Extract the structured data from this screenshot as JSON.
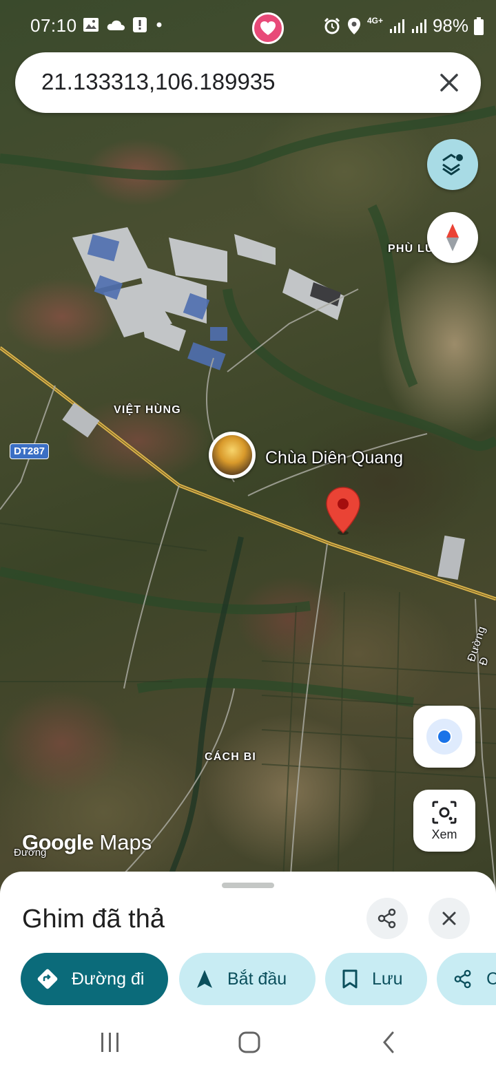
{
  "status_bar": {
    "time": "07:10",
    "battery": "98%",
    "network": "4G+",
    "icons": [
      "image-icon",
      "cloud-icon",
      "alert-icon",
      "dot-icon",
      "alarm-icon",
      "location-icon",
      "signal-icon",
      "battery-icon"
    ]
  },
  "search": {
    "query": "21.133313,106.189935"
  },
  "map": {
    "labels": {
      "phu_lu": "PHÙ LỦ",
      "viet_hung": "VIỆT HÙNG",
      "cach_bi": "CÁCH BI",
      "road_shield": "DT287",
      "road_side": "Đường Đ",
      "road_bottom": "Đường"
    },
    "poi": {
      "name": "Chùa Diên Quang"
    },
    "logo": {
      "google": "Google",
      "maps": "Maps"
    },
    "lens_label": "Xem"
  },
  "sheet": {
    "title": "Ghim đã thả",
    "chips": [
      {
        "label": "Đường đi",
        "icon": "directions-icon"
      },
      {
        "label": "Bắt đầu",
        "icon": "navigation-icon"
      },
      {
        "label": "Lưu",
        "icon": "bookmark-icon"
      },
      {
        "label": "C",
        "icon": "share-icon"
      }
    ]
  },
  "colors": {
    "primary_chip": "#0b6b7a",
    "secondary_chip": "#c8ecf3",
    "pin_red": "#ea4335",
    "location_blue": "#1a73e8",
    "road_shield": "#3b6fc4"
  }
}
